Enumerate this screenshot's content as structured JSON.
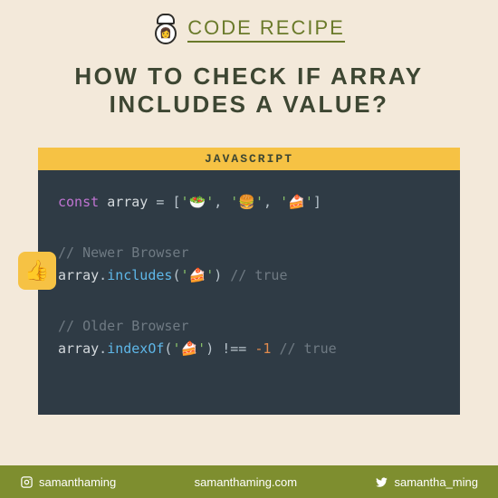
{
  "brand": "CODE RECIPE",
  "title_line1": "HOW TO CHECK IF ARRAY",
  "title_line2": "INCLUDES A VALUE?",
  "code": {
    "language_label": "JAVASCRIPT",
    "items": {
      "a": "🥗",
      "b": "🍔",
      "c": "🍰"
    },
    "kw_const": "const",
    "var_name": "array",
    "eq": "=",
    "comment_newer": "// Newer Browser",
    "fn_includes": "includes",
    "arg_cake": "🍰",
    "comment_true": "// true",
    "comment_older": "// Older Browser",
    "fn_indexOf": "indexOf",
    "neq": "!==",
    "neg1": "-1"
  },
  "badge_emoji": "👍",
  "footer": {
    "instagram": "samanthaming",
    "website": "samanthaming.com",
    "twitter": "samantha_ming"
  }
}
